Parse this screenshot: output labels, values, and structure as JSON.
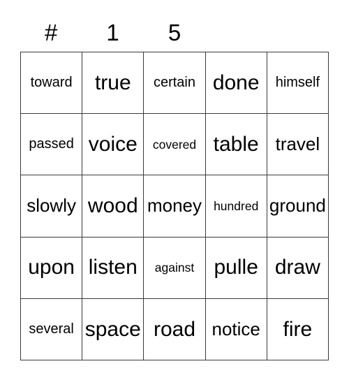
{
  "card": {
    "type": "bingo-card",
    "grid_size": "5x5",
    "header": {
      "labels": [
        "#",
        "1",
        "5",
        "",
        ""
      ]
    },
    "colors": {
      "background": "#ffffff",
      "text": "#000000",
      "grid_line": "#3a3a3a"
    },
    "rows": [
      {
        "cells": [
          {
            "word": "toward",
            "size": "m"
          },
          {
            "word": "true",
            "size": "xxl"
          },
          {
            "word": "certain",
            "size": "m"
          },
          {
            "word": "done",
            "size": "xxl"
          },
          {
            "word": "himself",
            "size": "m"
          }
        ]
      },
      {
        "cells": [
          {
            "word": "passed",
            "size": "m"
          },
          {
            "word": "voice",
            "size": "xxl"
          },
          {
            "word": "covered",
            "size": "s"
          },
          {
            "word": "table",
            "size": "xxl"
          },
          {
            "word": "travel",
            "size": "xl"
          }
        ]
      },
      {
        "cells": [
          {
            "word": "slowly",
            "size": "xl"
          },
          {
            "word": "wood",
            "size": "xxl"
          },
          {
            "word": "money",
            "size": "xl"
          },
          {
            "word": "hundred",
            "size": "s"
          },
          {
            "word": "ground",
            "size": "xl"
          }
        ]
      },
      {
        "cells": [
          {
            "word": "upon",
            "size": "xxl"
          },
          {
            "word": "listen",
            "size": "xxl"
          },
          {
            "word": "against",
            "size": "s"
          },
          {
            "word": "pulle",
            "size": "xxl"
          },
          {
            "word": "draw",
            "size": "xxl"
          }
        ]
      },
      {
        "cells": [
          {
            "word": "several",
            "size": "m"
          },
          {
            "word": "space",
            "size": "xxl"
          },
          {
            "word": "road",
            "size": "xxl"
          },
          {
            "word": "notice",
            "size": "xl"
          },
          {
            "word": "fire",
            "size": "xxl"
          }
        ]
      }
    ]
  }
}
